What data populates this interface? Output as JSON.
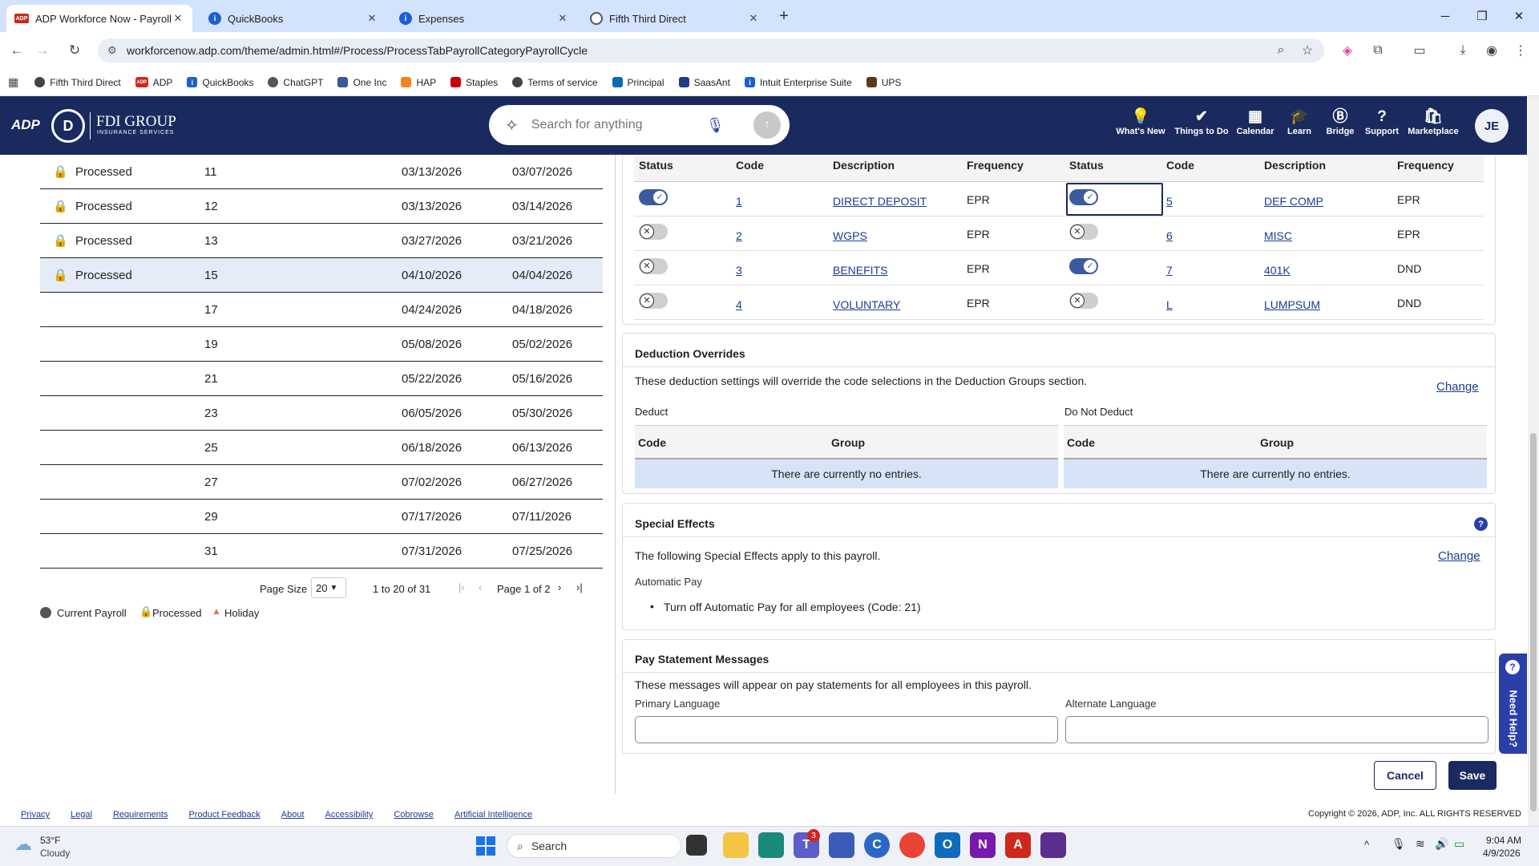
{
  "browser": {
    "tabs": [
      {
        "title": "ADP Workforce Now - Payroll S",
        "active": true,
        "icon": "adp-icon"
      },
      {
        "title": "QuickBooks",
        "active": false,
        "icon": "info-icon"
      },
      {
        "title": "Expenses",
        "active": false,
        "icon": "info-icon"
      },
      {
        "title": "Fifth Third Direct",
        "active": false,
        "icon": "globe-icon"
      }
    ],
    "url": "workforcenow.adp.com/theme/admin.html#/Process/ProcessTabPayrollCategoryPayrollCycle",
    "bookmarks": [
      "Fifth Third Direct",
      "ADP",
      "QuickBooks",
      "ChatGPT",
      "One Inc",
      "HAP",
      "Staples",
      "Terms of service",
      "Principal",
      "SaasAnt",
      "Intuit Enterprise Suite",
      "UPS"
    ]
  },
  "header": {
    "adp_logo": "ADP",
    "company_name": "FDI GROUP",
    "company_sub": "INSURANCE SERVICES",
    "search_placeholder": "Search for anything",
    "nav": [
      "What's New",
      "Things to Do",
      "Calendar",
      "Learn",
      "Bridge",
      "Support",
      "Marketplace"
    ],
    "avatar": "JE"
  },
  "payroll_table": {
    "rows": [
      {
        "status": "Processed",
        "locked": true,
        "num": "11",
        "date1": "03/13/2026",
        "date2": "03/07/2026"
      },
      {
        "status": "Processed",
        "locked": true,
        "num": "12",
        "date1": "03/13/2026",
        "date2": "03/14/2026"
      },
      {
        "status": "Processed",
        "locked": true,
        "num": "13",
        "date1": "03/27/2026",
        "date2": "03/21/2026"
      },
      {
        "status": "Processed",
        "locked": true,
        "num": "15",
        "date1": "04/10/2026",
        "date2": "04/04/2026",
        "selected": true
      },
      {
        "status": "",
        "locked": false,
        "num": "17",
        "date1": "04/24/2026",
        "date2": "04/18/2026"
      },
      {
        "status": "",
        "locked": false,
        "num": "19",
        "date1": "05/08/2026",
        "date2": "05/02/2026"
      },
      {
        "status": "",
        "locked": false,
        "num": "21",
        "date1": "05/22/2026",
        "date2": "05/16/2026"
      },
      {
        "status": "",
        "locked": false,
        "num": "23",
        "date1": "06/05/2026",
        "date2": "05/30/2026"
      },
      {
        "status": "",
        "locked": false,
        "num": "25",
        "date1": "06/18/2026",
        "date2": "06/13/2026"
      },
      {
        "status": "",
        "locked": false,
        "num": "27",
        "date1": "07/02/2026",
        "date2": "06/27/2026"
      },
      {
        "status": "",
        "locked": false,
        "num": "29",
        "date1": "07/17/2026",
        "date2": "07/11/2026"
      },
      {
        "status": "",
        "locked": false,
        "num": "31",
        "date1": "07/31/2026",
        "date2": "07/25/2026"
      }
    ],
    "pager": {
      "page_size_label": "Page Size",
      "page_size": "20",
      "range": "1 to 20 of 31",
      "page": "Page 1 of 2"
    },
    "legend": [
      "Current Payroll",
      "Processed",
      "Holiday"
    ]
  },
  "deduction_groups": {
    "headers": [
      "Status",
      "Code",
      "Description",
      "Frequency"
    ],
    "left": [
      {
        "on": true,
        "code": "1",
        "desc": "DIRECT DEPOSIT",
        "freq": "EPR"
      },
      {
        "on": false,
        "code": "2",
        "desc": "WGPS",
        "freq": "EPR"
      },
      {
        "on": false,
        "code": "3",
        "desc": "BENEFITS",
        "freq": "EPR"
      },
      {
        "on": false,
        "code": "4",
        "desc": "VOLUNTARY",
        "freq": "EPR"
      }
    ],
    "right": [
      {
        "on": true,
        "code": "5",
        "desc": "DEF COMP",
        "freq": "EPR"
      },
      {
        "on": false,
        "code": "6",
        "desc": "MISC",
        "freq": "EPR"
      },
      {
        "on": true,
        "code": "7",
        "desc": "401K",
        "freq": "DND"
      },
      {
        "on": false,
        "code": "L",
        "desc": "LUMPSUM",
        "freq": "DND"
      }
    ]
  },
  "deduction_overrides": {
    "title": "Deduction Overrides",
    "description": "These deduction settings will override the code selections in the Deduction Groups section.",
    "change": "Change",
    "deduct_label": "Deduct",
    "do_not_deduct_label": "Do Not Deduct",
    "col_code": "Code",
    "col_group": "Group",
    "empty": "There are currently no entries."
  },
  "special_effects": {
    "title": "Special Effects",
    "description": "The following Special Effects apply to this payroll.",
    "change": "Change",
    "subhead": "Automatic Pay",
    "item": "Turn off Automatic Pay for all employees (Code: 21)"
  },
  "pay_statement": {
    "title": "Pay Statement Messages",
    "description": "These messages will appear on pay statements for all employees in this payroll.",
    "primary_label": "Primary Language",
    "alternate_label": "Alternate Language",
    "primary_value": "",
    "alternate_value": ""
  },
  "actions": {
    "cancel": "Cancel",
    "save": "Save",
    "need_help": "Need Help?"
  },
  "footer": {
    "links": [
      "Privacy",
      "Legal",
      "Requirements",
      "Product Feedback",
      "About",
      "Accessibility",
      "Cobrowse",
      "Artificial Intelligence"
    ],
    "copyright": "Copyright © 2026, ADP, Inc. ALL RIGHTS RESERVED"
  },
  "taskbar": {
    "temp": "53°F",
    "weather": "Cloudy",
    "search": "Search",
    "time": "9:04 AM",
    "date": "4/9/2026",
    "teams_badge": "3"
  }
}
